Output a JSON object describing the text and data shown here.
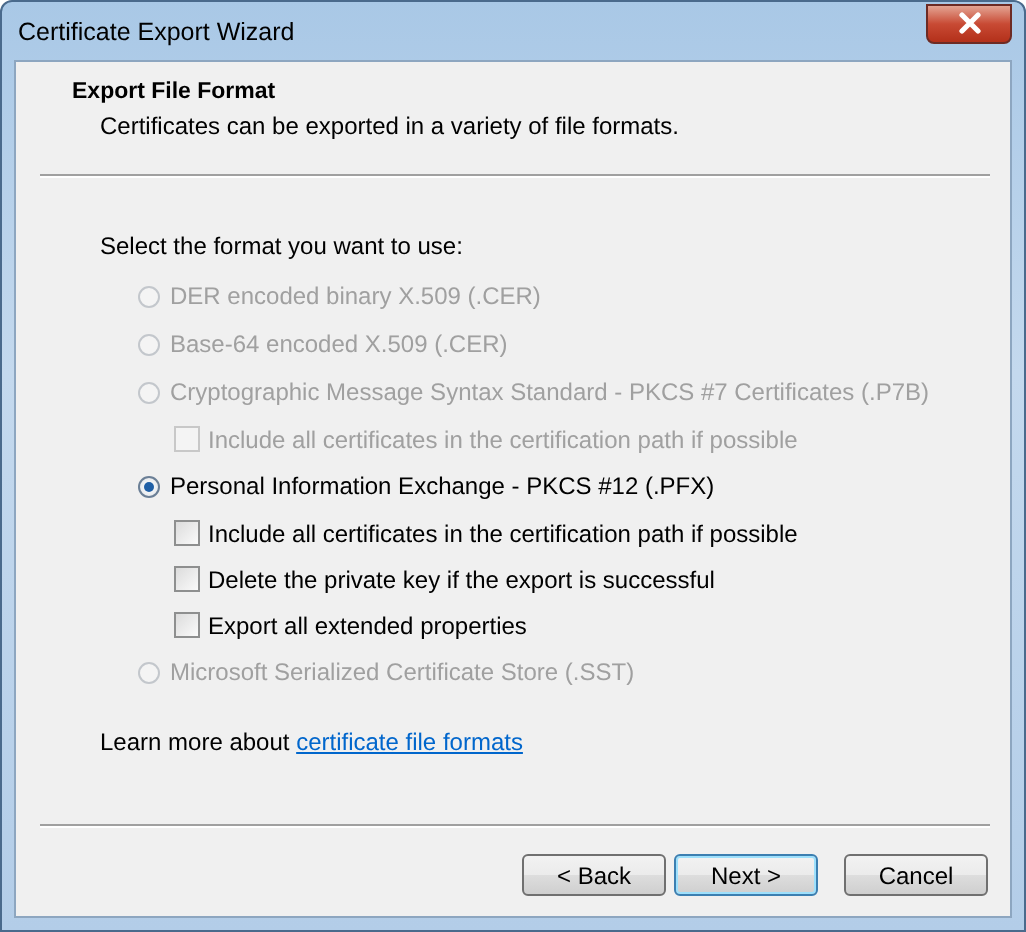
{
  "window": {
    "title": "Certificate Export Wizard"
  },
  "header": {
    "title": "Export File Format",
    "subtitle": "Certificates can be exported in a variety of file formats."
  },
  "prompt": "Select the format you want to use:",
  "options": [
    {
      "label": "DER encoded binary X.509 (.CER)",
      "selected": false,
      "disabled": true
    },
    {
      "label": "Base-64 encoded X.509 (.CER)",
      "selected": false,
      "disabled": true
    },
    {
      "label": "Cryptographic Message Syntax Standard - PKCS #7 Certificates (.P7B)",
      "selected": false,
      "disabled": true,
      "children": [
        {
          "label": "Include all certificates in the certification path if possible",
          "checked": false,
          "disabled": true
        }
      ]
    },
    {
      "label": "Personal Information Exchange - PKCS #12 (.PFX)",
      "selected": true,
      "disabled": false,
      "children": [
        {
          "label": "Include all certificates in the certification path if possible",
          "checked": false,
          "disabled": false
        },
        {
          "label": "Delete the private key if the export is successful",
          "checked": false,
          "disabled": false
        },
        {
          "label": "Export all extended properties",
          "checked": false,
          "disabled": false
        }
      ]
    },
    {
      "label": "Microsoft Serialized Certificate Store (.SST)",
      "selected": false,
      "disabled": true
    }
  ],
  "learn_more": {
    "text": "Learn more about",
    "link": "certificate file formats"
  },
  "buttons": [
    {
      "label": "< Back",
      "default": false
    },
    {
      "label": "Next >",
      "default": true
    },
    {
      "label": "Cancel",
      "default": false
    }
  ]
}
